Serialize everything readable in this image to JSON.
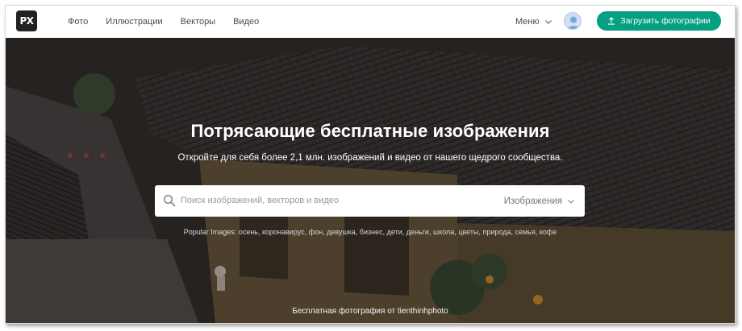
{
  "brand": {
    "logo_text": "PX"
  },
  "nav": {
    "items": [
      {
        "label": "Фото"
      },
      {
        "label": "Иллюстрации"
      },
      {
        "label": "Векторы"
      },
      {
        "label": "Видео"
      }
    ],
    "menu_label": "Меню",
    "upload_label": "Загрузить фотографии"
  },
  "hero": {
    "title": "Потрясающие бесплатные изображения",
    "subtitle": "Откройте для себя более 2,1 млн. изображений и видео от нашего щедрого сообщества.",
    "search": {
      "placeholder": "Поиск изображений, векторов и видео",
      "value": "",
      "type_label": "Изображения"
    },
    "popular_prefix": "Popular Images:",
    "popular_tags": [
      "осень",
      "коронавирус",
      "фон",
      "девушка",
      "бизнес",
      "дети",
      "деньги",
      "школа",
      "цветы",
      "природа",
      "семья",
      "кофе"
    ],
    "credit": "Бесплатная фотография от tienthinhphoto"
  },
  "colors": {
    "accent": "#05a081",
    "logo_bg": "#222222",
    "text": "#4a4a4a"
  },
  "icons": [
    "chevron-down-icon",
    "avatar-icon",
    "upload-icon",
    "search-icon"
  ]
}
